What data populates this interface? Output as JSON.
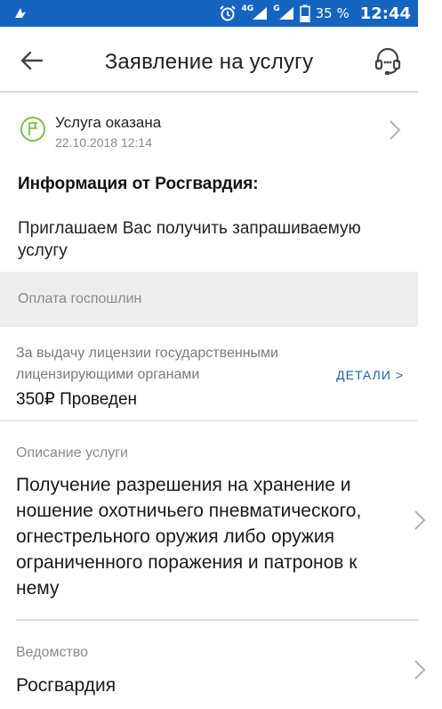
{
  "status_bar": {
    "network_1": "4G",
    "network_2": "G",
    "battery": "35 %",
    "time": "12:44",
    "icons": [
      "notification-icon",
      "alarm-icon",
      "signal-icon",
      "battery-icon"
    ]
  },
  "app_bar": {
    "title": "Заявление на услугу",
    "icons": [
      "back-arrow-icon",
      "headset-icon"
    ]
  },
  "status": {
    "title": "Услуга оказана",
    "date": "22.10.2018 12:14",
    "icon": "flag-icon",
    "color": "#7cc04b"
  },
  "info": {
    "heading": "Информация от Росгвардия:",
    "text": "Приглашаем Вас получить запрашиваемую услугу"
  },
  "fees": {
    "header": "Оплата госпошлин",
    "description": "За выдачу лицензии государственными лицензирующими органами",
    "amount": "350₽ Проведен",
    "details_link": "ДЕТАЛИ >"
  },
  "service": {
    "label": "Описание услуги",
    "text": "Получение разрешения на хранение и ношение охотничьего пневматического, огнестрельного оружия либо оружия ограниченного поражения и патронов к нему"
  },
  "agency": {
    "label": "Ведомство",
    "value": "Росгвардия"
  },
  "colors": {
    "status_bar": "#1564c0",
    "link": "#1d5ea8",
    "success": "#7cc04b"
  }
}
